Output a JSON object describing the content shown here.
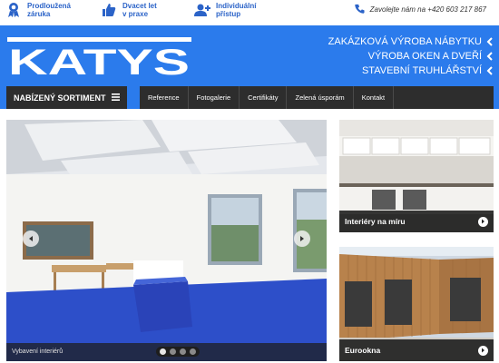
{
  "features": [
    {
      "icon": "ribbon-icon",
      "line1": "Prodloužená",
      "line2": "záruka"
    },
    {
      "icon": "thumbs-up-icon",
      "line1": "Dvacet let",
      "line2": "v praxe"
    },
    {
      "icon": "user-add-icon",
      "line1": "Individuální",
      "line2": "přístup"
    }
  ],
  "contact": {
    "icon": "phone-icon",
    "label": "Zavolejte nám na",
    "phone": "+420 603 217 867"
  },
  "logo_text": "KATYS",
  "taglines": [
    "ZAKÁZKOVÁ VÝROBA NÁBYTKU",
    "VÝROBA OKEN A DVEŘÍ",
    "STAVEBNÍ TRUHLÁŘSTVÍ"
  ],
  "sortiment_label": "NABÍZENÝ SORTIMENT",
  "nav": [
    "Reference",
    "Fotogalerie",
    "Certifikáty",
    "Zelená úsporám",
    "Kontakt"
  ],
  "slider": {
    "caption": "Vybavení interiérů",
    "slides": 4,
    "active": 1
  },
  "cards": [
    {
      "label": "Interiéry na míru"
    },
    {
      "label": "Eurookna"
    }
  ],
  "colors": {
    "brand_blue": "#2b7bec",
    "nav_dark": "#2d2d2d",
    "feature_blue": "#2b63c8"
  }
}
